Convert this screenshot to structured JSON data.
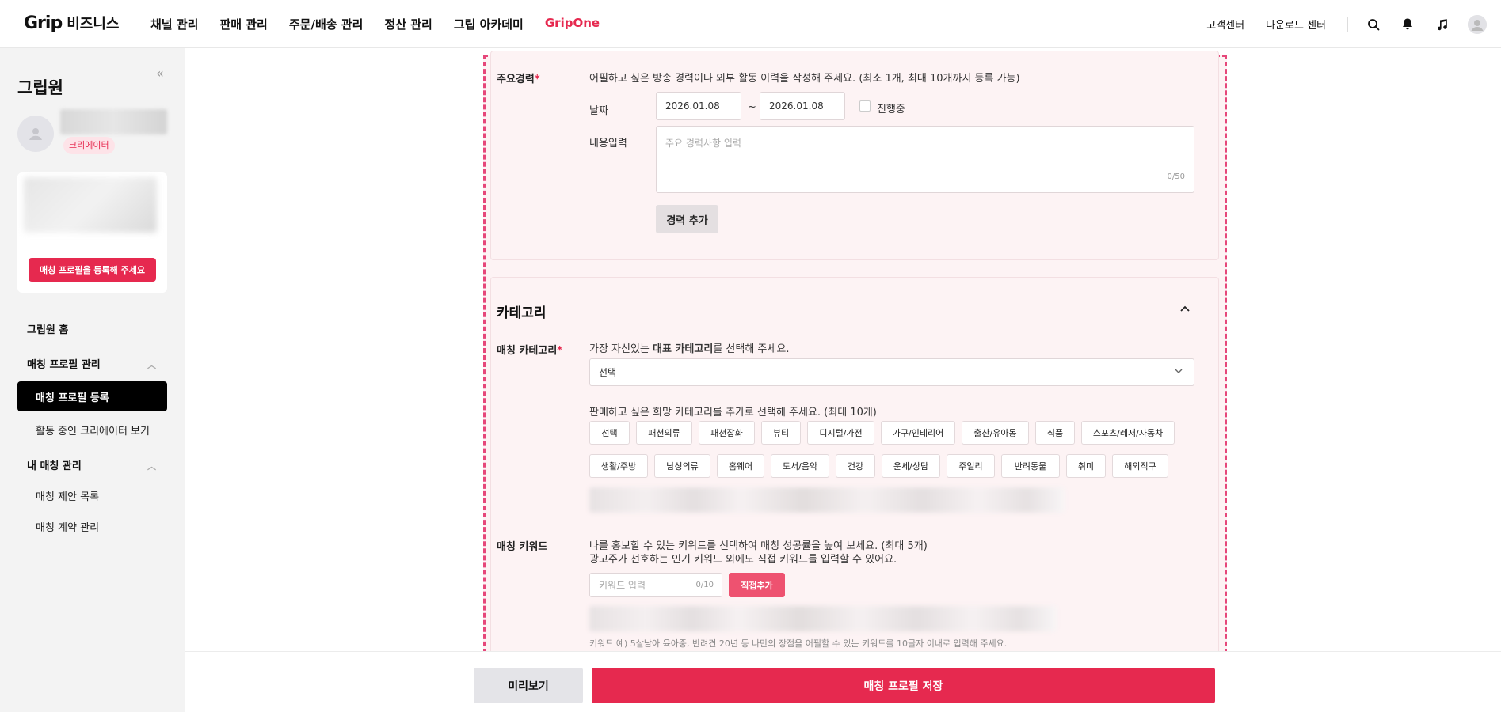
{
  "header": {
    "logo_brand": "Grip",
    "logo_suffix": "비즈니스",
    "nav": [
      "채널 관리",
      "판매 관리",
      "주문/배송 관리",
      "정산 관리",
      "그립 아카데미",
      "GripOne"
    ],
    "right_links": [
      "고객센터",
      "다운로드 센터"
    ],
    "icons": [
      "search-icon",
      "bell-icon",
      "music-icon",
      "avatar"
    ]
  },
  "sidebar": {
    "title": "그립원",
    "badge": "크리에이터",
    "card_button": "매칭 프로필을 등록해 주세요",
    "home": "그립원 홈",
    "group1": "매칭 프로필 관리",
    "group1_items": [
      "매칭 프로필 등록",
      "활동 중인 크리에이터 보기"
    ],
    "group2": "내 매칭 관리",
    "group2_items": [
      "매칭 제안 목록",
      "매칭 계약 관리"
    ]
  },
  "career": {
    "label": "주요경력",
    "required_mark": "*",
    "description": "어필하고 싶은 방송 경력이나 외부 활동 이력을 작성해 주세요. (최소 1개, 최대 10개까지 등록 가능)",
    "date_label": "날짜",
    "start_date": "2026.01.08",
    "tilde": "~",
    "end_date": "2026.01.08",
    "ongoing_label": "진행중",
    "content_label": "내용입력",
    "content_placeholder": "주요 경력사항 입력",
    "content_count": "0/50",
    "add_button": "경력 추가"
  },
  "category": {
    "section_title": "카테고리",
    "matching_label": "매칭 카테고리",
    "required_mark": "*",
    "desc_pre": "가장 자신있는 ",
    "desc_bold": "대표 카테고리",
    "desc_post": "를 선택해 주세요.",
    "select_value": "선택",
    "extra_desc": "판매하고 싶은 희망 카테고리를 추가로 선택해 주세요. (최대 10개)",
    "chips_row1": [
      "선택",
      "패션의류",
      "패션잡화",
      "뷰티",
      "디지털/가전",
      "가구/인테리어",
      "출산/유아동",
      "식품",
      "스포츠/레저/자동차"
    ],
    "chips_row2": [
      "생활/주방",
      "남성의류",
      "홈웨어",
      "도서/음악",
      "건강",
      "운세/상담",
      "주얼리",
      "반려동물",
      "취미",
      "해외직구"
    ]
  },
  "keyword": {
    "label": "매칭 키워드",
    "desc_line1": "나를 홍보할 수 있는 키워드를 선택하여 매칭 성공률을 높여 보세요. (최대 5개)",
    "desc_line2": "광고주가 선호하는 인기 키워드 외에도 직접 키워드를 입력할 수 있어요.",
    "input_placeholder": "키워드 입력",
    "input_count": "0/10",
    "add_button": "직접추가",
    "hint": "키워드 예) 5살남아 육아중, 반려견 20년 등 나만의 장점을 어필할 수 있는 키워드를 10글자 이내로 입력해 주세요."
  },
  "footer": {
    "preview_button": "미리보기",
    "save_button": "매칭 프로필 저장"
  },
  "colors": {
    "accent": "#e6294f",
    "dashed_border": "#e6477a",
    "panel_bg": "#fdf3f4"
  }
}
